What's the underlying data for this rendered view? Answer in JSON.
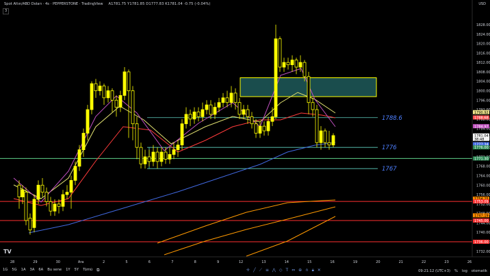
{
  "header": {
    "title": "Spot Altın/ABD Doları · 4s · PEPPERSTONE · TradingView",
    "ohlc": "A1781.75  Y1781.85  D1777.83  K1781.04  -0.75 (-0.04%)",
    "indicator_toggle": "3",
    "currency": "USD"
  },
  "price_axis": {
    "ticks": [
      "1828.00",
      "1824.00",
      "1820.00",
      "1816.00",
      "1812.00",
      "1808.00",
      "1804.00",
      "1800.00",
      "1796.00",
      "1792.00",
      "1788.00",
      "1784.00",
      "1780.00",
      "1776.00",
      "1772.00",
      "1768.00",
      "1764.00",
      "1760.00",
      "1756.00",
      "1752.00",
      "1748.00",
      "1744.00",
      "1740.00",
      "1736.00",
      "1732.00"
    ],
    "badges": [
      {
        "label": "1790.92",
        "color": "#f0e68c",
        "text_color": "#000"
      },
      {
        "label": "1788.68",
        "color": "#ff4d4d",
        "text_color": "#fff"
      },
      {
        "label": "1784.97",
        "color": "#c050c0",
        "text_color": "#fff"
      },
      {
        "label": "1781.04",
        "color": "#f5f5f5",
        "text_color": "#000"
      },
      {
        "label": "38:48",
        "color": "#f5f5f5",
        "text_color": "#000"
      },
      {
        "label": "1777.34",
        "color": "#4169e1",
        "text_color": "#fff"
      },
      {
        "label": "1776.00",
        "color": "#2e8b57",
        "text_color": "#fff"
      },
      {
        "label": "1771.30",
        "color": "#2e8b57",
        "text_color": "#fff"
      },
      {
        "label": "1754.25",
        "color": "#ff8c00",
        "text_color": "#000"
      },
      {
        "label": "1753.09",
        "color": "#ff3030",
        "text_color": "#fff"
      },
      {
        "label": "1747.19",
        "color": "#ff8c00",
        "text_color": "#000"
      },
      {
        "label": "1745.00",
        "color": "#ff3030",
        "text_color": "#fff"
      },
      {
        "label": "1736.00",
        "color": "#ff3030",
        "text_color": "#fff"
      }
    ]
  },
  "time_axis": {
    "labels": [
      "28",
      "29",
      "30",
      "Ara",
      "2",
      "5",
      "6",
      "7",
      "8",
      "9",
      "12",
      "13",
      "14",
      "15",
      "16",
      "19",
      "20",
      "21",
      "22",
      "23",
      "26"
    ]
  },
  "annotations": {
    "label_1788": "1788.6",
    "label_1776": "1776",
    "label_1767": "1767"
  },
  "timeframes": [
    "1G",
    "5G",
    "1A",
    "3A",
    "6A",
    "Bu sene",
    "1Y",
    "5Y",
    "Tümü"
  ],
  "status": {
    "time": "09:21:12 (UTC+3)",
    "percent": "%",
    "log": "log",
    "auto": "otomatik"
  },
  "colors": {
    "candle": "#ffff00",
    "ma_fast": "#c050c0",
    "ma_mid": "#e0e070",
    "ma_slow_red": "#ff3b3b",
    "ma_blue": "#4169e1",
    "ma_orange": "#ff9900",
    "support_green": "#5fd18a",
    "red_level": "#ff3030",
    "box_fill": "#1a4d4d",
    "box_border": "#ffff00"
  }
}
